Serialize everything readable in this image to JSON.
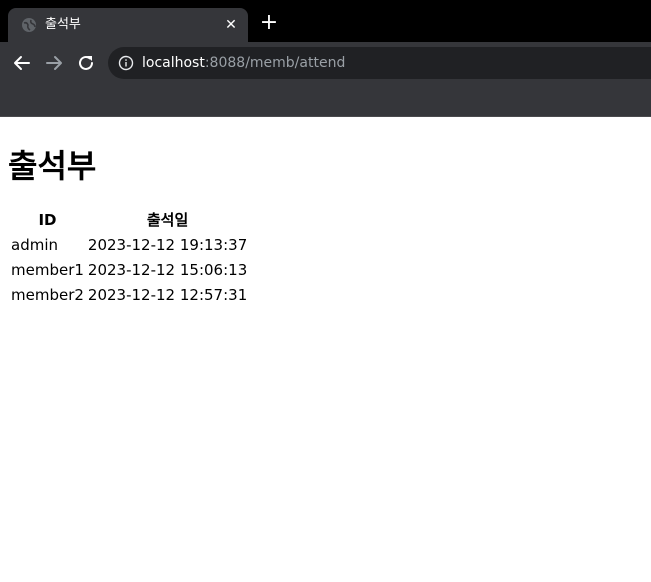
{
  "browser": {
    "tab_title": "출석부",
    "close_glyph": "✕",
    "new_tab_glyph": "+",
    "url_host": "localhost",
    "url_rest": ":8088/memb/attend"
  },
  "page": {
    "heading": "출석부",
    "table": {
      "headers": [
        "ID",
        "출석일"
      ],
      "rows": [
        [
          "admin",
          "2023-12-12 19:13:37"
        ],
        [
          "member1",
          "2023-12-12 15:06:13"
        ],
        [
          "member2",
          "2023-12-12 12:57:31"
        ]
      ]
    }
  }
}
